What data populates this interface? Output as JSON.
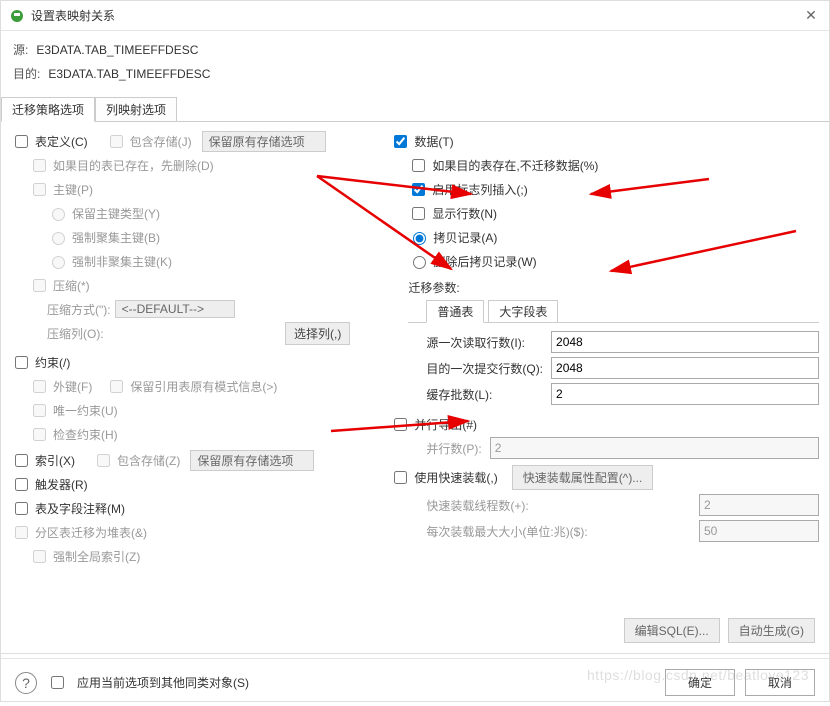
{
  "window": {
    "title": "设置表映射关系"
  },
  "header": {
    "sourceLabel": "源:",
    "sourceValue": "E3DATA.TAB_TIMEEFFDESC",
    "targetLabel": "目的:",
    "targetValue": "E3DATA.TAB_TIMEEFFDESC"
  },
  "tabs": {
    "tab1": "迁移策略选项",
    "tab2": "列映射选项"
  },
  "left": {
    "tableDef": "表定义(C)",
    "incStorage": "包含存储(J)",
    "storageSel": "保留原有存储选项",
    "dropIfExist": "如果目的表已存在，先删除(D)",
    "pk": "主键(P)",
    "keepPkType": "保留主键类型(Y)",
    "forceCluster": "强制聚集主键(B)",
    "forceNonCluster": "强制非聚集主键(K)",
    "compress": "压缩(*)",
    "compressMode": "压缩方式(\"):",
    "compressModeVal": "<--DEFAULT-->",
    "compressCol": "压缩列(O):",
    "selectCol": "选择列(,)",
    "constraints": "约束(/)",
    "fk": "外键(F)",
    "keepSchema": "保留引用表原有模式信息(>)",
    "unique": "唯一约束(U)",
    "check": "检查约束(H)",
    "index": "索引(X)",
    "incStorage2": "包含存储(Z)",
    "storageSel2": "保留原有存储选项",
    "trigger": "触发器(R)",
    "tabComment": "表及字段注释(M)",
    "part2heap": "分区表迁移为堆表(&)",
    "forceGlobalIdx": "强制全局索引(Z)"
  },
  "right": {
    "data": "数据(T)",
    "skipIfExist": "如果目的表存在,不迁移数据(%)",
    "enableIdentity": "启用标志列插入(;)",
    "showRows": "显示行数(N)",
    "copyRec": "拷贝记录(A)",
    "delAfterCopy": "删除后拷贝记录(W)",
    "migParams": "迁移参数:",
    "tab_normal": "普通表",
    "tab_lob": "大字段表",
    "srcFetch": "源一次读取行数(I):",
    "srcFetchVal": "2048",
    "dstCommit": "目的一次提交行数(Q):",
    "dstCommitVal": "2048",
    "bufBatch": "缓存批数(L):",
    "bufBatchVal": "2",
    "parallel": "并行导出(#)",
    "parallelCount": "并行数(P):",
    "parallelCountVal": "2",
    "fastLoad": "使用快速装载(,)",
    "fastLoadCfg": "快速装载属性配置(^)...",
    "fastLoadThreads": "快速装载线程数(+):",
    "fastLoadThreadsVal": "2",
    "fastLoadSize": "每次装载最大大小(单位:兆)($):",
    "fastLoadSizeVal": "50"
  },
  "footer": {
    "editSql": "编辑SQL(E)...",
    "autoGen": "自动生成(G)",
    "applyAll": "应用当前选项到其他同类对象(S)",
    "ok": "确定",
    "cancel": "取消"
  },
  "watermark": "https://blog.csdn.net/beatlove123"
}
